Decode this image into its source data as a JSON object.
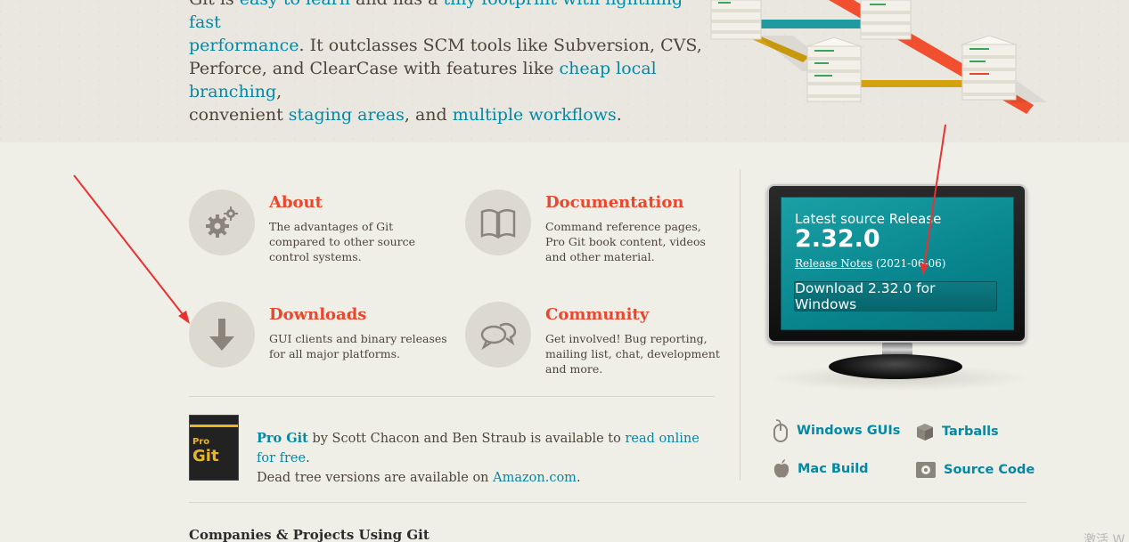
{
  "hero": {
    "line1_prefix": "Git is ",
    "link_easy": "easy to learn",
    "line1_mid": " and has a ",
    "link_tiny": "tiny footprint with lightning fast",
    "link_perf": "performance",
    "line2_rest": ". It outclasses SCM tools like Subversion, CVS,",
    "line3_prefix": "Perforce, and ClearCase with features like ",
    "link_branching": "cheap local branching",
    "line3_suffix": ",",
    "line4_prefix": "convenient ",
    "link_staging": "staging areas",
    "line4_mid": ", and ",
    "link_workflows": "multiple workflows",
    "line4_suffix": "."
  },
  "features": [
    {
      "title": "About",
      "icon": "gears-icon",
      "desc": "The advantages of Git compared to other source control systems."
    },
    {
      "title": "Documentation",
      "icon": "book-icon",
      "desc": "Command reference pages, Pro Git book content, videos and other material."
    },
    {
      "title": "Downloads",
      "icon": "download-arrow-icon",
      "desc": "GUI clients and binary releases for all major platforms."
    },
    {
      "title": "Community",
      "icon": "chat-bubbles-icon",
      "desc": "Get involved! Bug reporting, mailing list, chat, development and more."
    }
  ],
  "book": {
    "cover_title": "Pro Git",
    "cover_pro": "Pro",
    "cover_git": "Git",
    "link_progit": "Pro Git",
    "text_mid": " by Scott Chacon and Ben Straub is available to ",
    "link_read": "read online for free",
    "text_end1": ".",
    "text_line2": "Dead tree versions are available on ",
    "link_amazon": "Amazon.com",
    "text_end2": "."
  },
  "release": {
    "label": "Latest source Release",
    "version": "2.32.0",
    "notes_link": "Release Notes",
    "date": " (2021-06-06)",
    "download_button": "Download 2.32.0 for Windows"
  },
  "download_links": [
    {
      "label": "Windows GUIs",
      "icon": "mouse-icon"
    },
    {
      "label": "Tarballs",
      "icon": "box-icon"
    },
    {
      "label": "Mac Build",
      "icon": "apple-icon"
    },
    {
      "label": "Source Code",
      "icon": "gear-box-icon"
    }
  ],
  "companies_heading": "Companies & Projects Using Git",
  "corner_text": "激活 W",
  "colors": {
    "accent": "#e9472e",
    "link": "#0388a6",
    "screen": "#0b8f96",
    "annotation_arrow": "#e83232"
  }
}
